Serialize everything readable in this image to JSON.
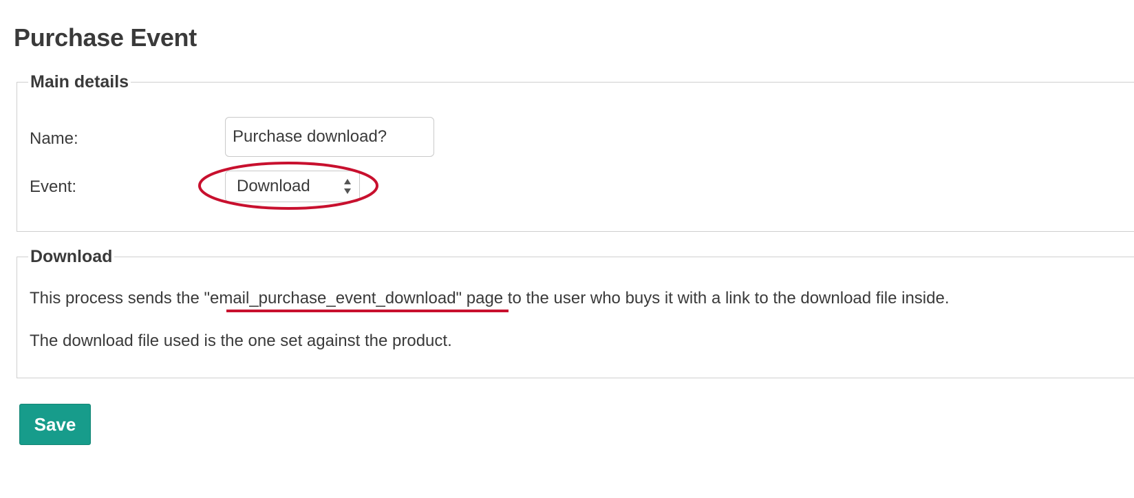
{
  "page": {
    "title": "Purchase Event"
  },
  "main_details": {
    "legend": "Main details",
    "name_label": "Name:",
    "name_value": "Purchase download?",
    "event_label": "Event:",
    "event_selected": "Download"
  },
  "download_section": {
    "legend": "Download",
    "paragraph_1": "This process sends the \"email_purchase_event_download\" page to the user who buys it with a link to the download file inside.",
    "paragraph_2": "The download file used is the one set against the product."
  },
  "actions": {
    "save_label": "Save"
  },
  "icons": {
    "select_arrows": "up-down-arrows-icon"
  },
  "colors": {
    "accent_button": "#179c8b",
    "annotation_red": "#c8102e",
    "text": "#3a3a3a",
    "border": "#cfcfcf"
  }
}
